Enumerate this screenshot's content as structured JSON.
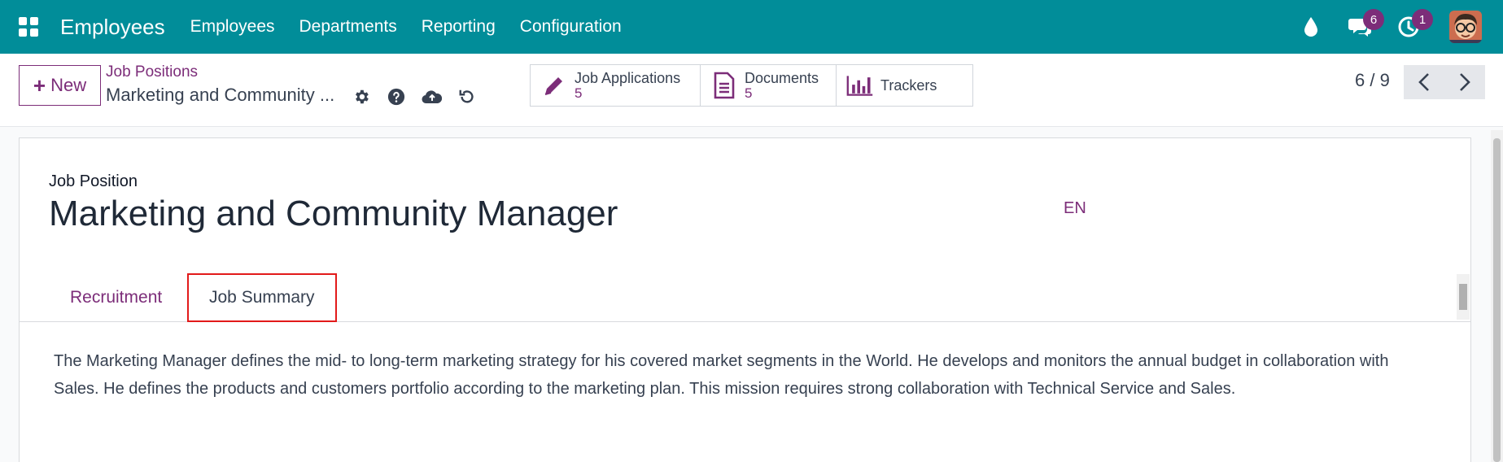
{
  "navbar": {
    "app_title": "Employees",
    "menu": [
      "Employees",
      "Departments",
      "Reporting",
      "Configuration"
    ],
    "chat_badge": "6",
    "activity_badge": "1",
    "icons": [
      "apps-grid-icon",
      "droplet-icon",
      "chat-icon",
      "clock-icon",
      "avatar"
    ]
  },
  "control": {
    "new_label": "New",
    "breadcrumb_parent": "Job Positions",
    "breadcrumb_current": "Marketing and Community ...",
    "smart_buttons": [
      {
        "label": "Job Applications",
        "count": "5",
        "icon": "pencil-icon"
      },
      {
        "label": "Documents",
        "count": "5",
        "icon": "document-icon"
      },
      {
        "label": "Trackers",
        "count": "",
        "icon": "bar-chart-icon"
      }
    ],
    "pager": "6 / 9"
  },
  "form": {
    "field_label": "Job Position",
    "title": "Marketing and Community Manager",
    "lang": "EN",
    "tabs": [
      "Recruitment",
      "Job Summary"
    ],
    "active_tab": "Job Summary",
    "summary": "The Marketing Manager defines the mid- to long-term marketing strategy for his covered market segments in the World. He develops and monitors the annual budget in collaboration with Sales. He defines the products and customers portfolio according to the marketing plan. This mission requires strong collaboration with Technical Service and Sales."
  },
  "colors": {
    "navbar": "#018d99",
    "accent": "#7c2d79",
    "highlight": "#e21a1a"
  }
}
